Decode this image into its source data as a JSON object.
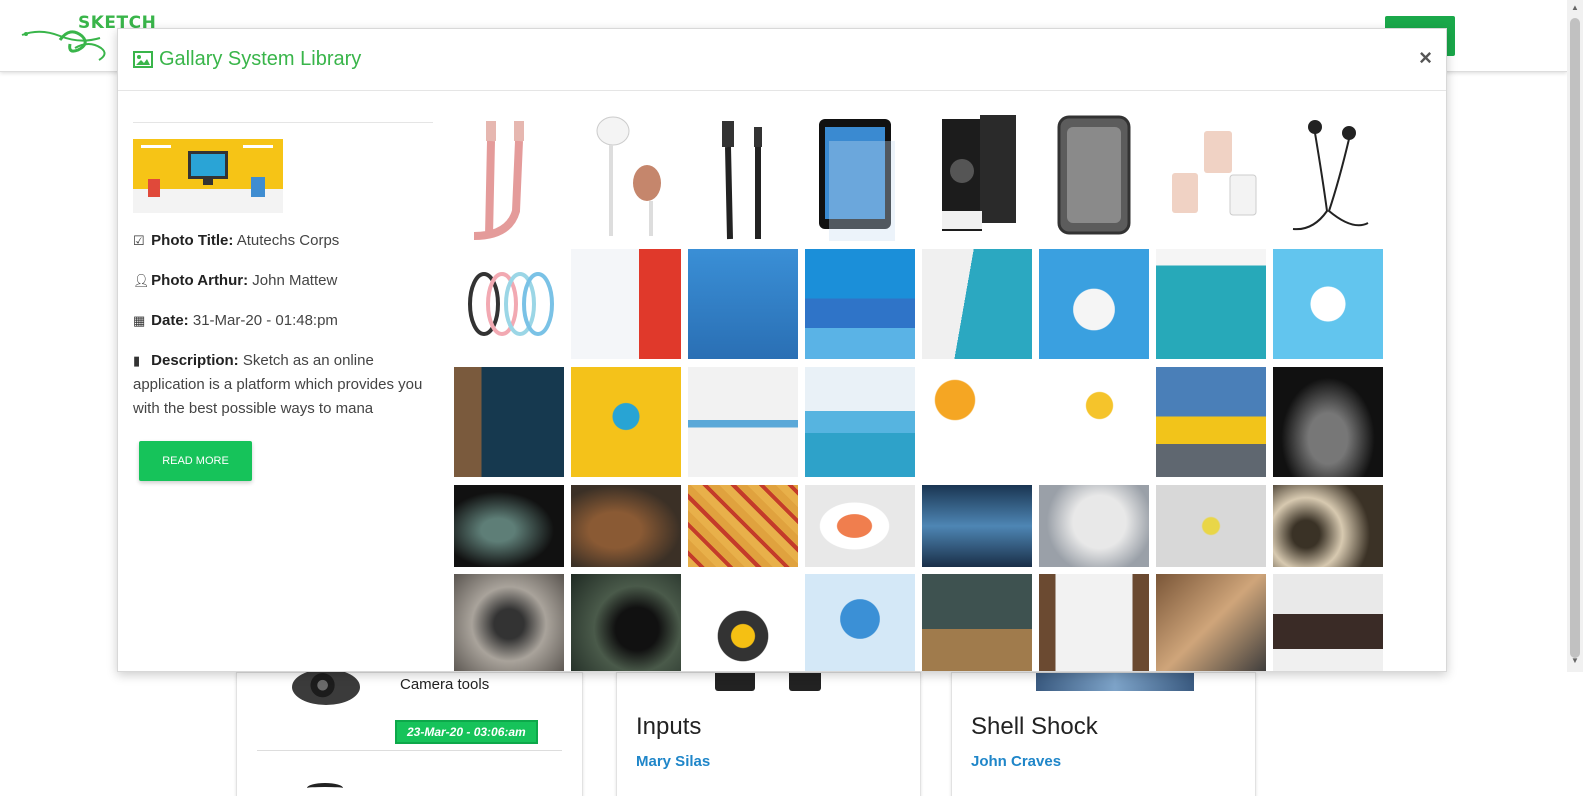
{
  "background": {
    "logo_text": "SKETCH",
    "cards": [
      {
        "title": "Camera tools",
        "date": "23-Mar-20 - 03:06:am"
      },
      {
        "title": "Inputs",
        "author": "Mary Silas"
      },
      {
        "title": "Shell Shock",
        "author": "John Craves"
      }
    ]
  },
  "modal": {
    "title": "Gallary System Library",
    "close_label": "×",
    "photo": {
      "title_label": "Photo Title:",
      "title_value": "Atutechs Corps",
      "author_label": "Photo Arthur:",
      "author_value": "John Mattew",
      "date_label": "Date:",
      "date_value": "31-Mar-20 - 01:48:pm",
      "desc_label": "Description:",
      "desc_value": "Sketch as an online application is a platform which provides you with the best possible ways to mana",
      "read_more": "READ MORE"
    },
    "gallery": [
      "usb-cable-rose",
      "earphone-rose",
      "usb-cable-black",
      "tablet-shellshock",
      "phone-case-box",
      "phone-case-clear",
      "otg-adapters",
      "earphone-black",
      "cables-colored",
      "web-design-solution",
      "responsive-web-design",
      "seo-affordable-website",
      "responsive-design-teal",
      "web-development-icons",
      "web-design-banner",
      "seo-circle",
      "web-design-dark",
      "web-design-yellow",
      "app-development",
      "seo-programming",
      "bitcoin-chart",
      "bitcoin-key",
      "yellow-sports-car",
      "dark-sports-car",
      "green-car-night",
      "cookies",
      "snacks",
      "salmon-dish",
      "camera-desk",
      "dancer",
      "camera-flowers",
      "camera-lenses",
      "vintage-camera",
      "camera-closeup",
      "support-laptop",
      "graduation-globe",
      "books-chalkboard",
      "planning-notebook",
      "handshake-laptop",
      "team-laptop"
    ]
  }
}
